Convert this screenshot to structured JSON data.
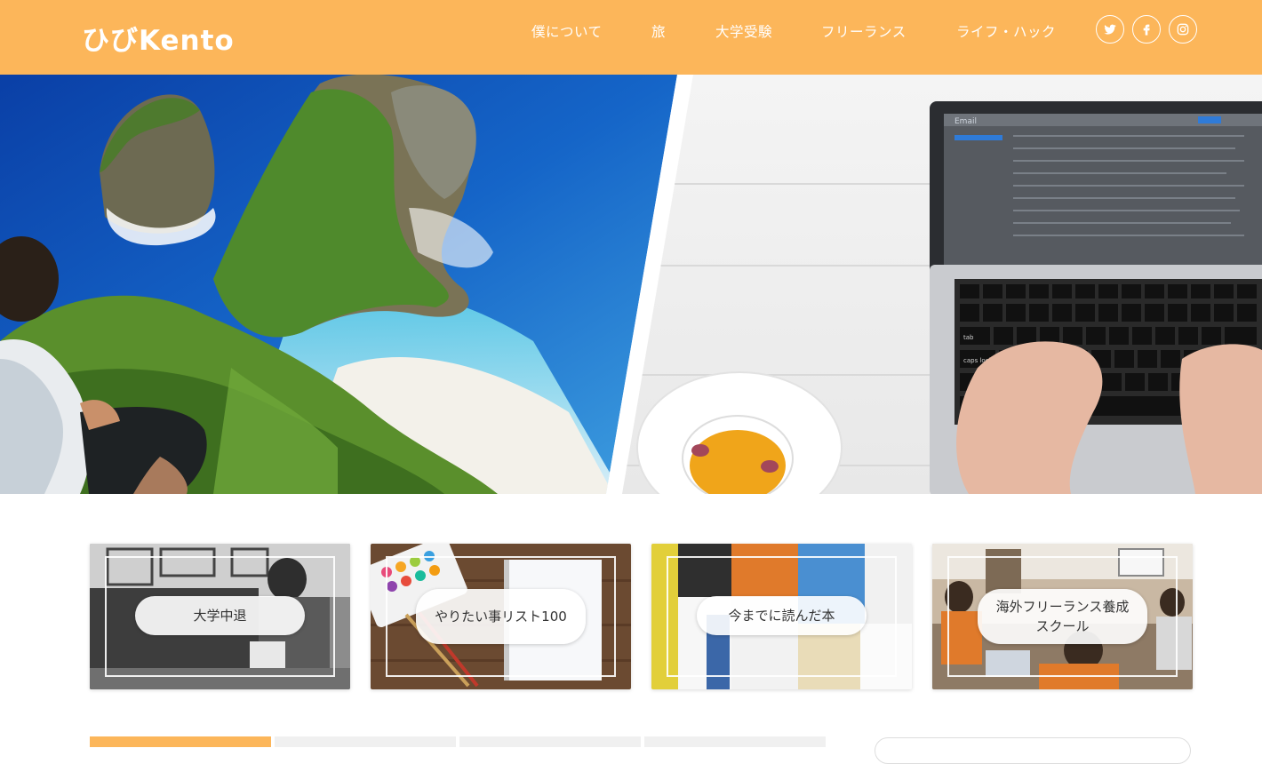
{
  "header": {
    "logo": "ひびKento",
    "nav": [
      {
        "label": "僕について"
      },
      {
        "label": "旅"
      },
      {
        "label": "大学受験"
      },
      {
        "label": "フリーランス"
      },
      {
        "label": "ライフ・ハック"
      }
    ],
    "social": [
      {
        "icon": "twitter-icon"
      },
      {
        "icon": "facebook-icon"
      },
      {
        "icon": "instagram-icon"
      }
    ]
  },
  "hero": {
    "right_laptop_screen_title": "Email",
    "keyboard_keys": [
      "tab",
      "caps lock"
    ]
  },
  "cards": [
    {
      "label": "大学中退"
    },
    {
      "label": "やりたい事リスト100"
    },
    {
      "label": "今までに読んだ本"
    },
    {
      "label": "海外フリーランス養成スクール"
    }
  ],
  "colors": {
    "accent": "#fcb65a",
    "header_text": "#ffffff"
  }
}
